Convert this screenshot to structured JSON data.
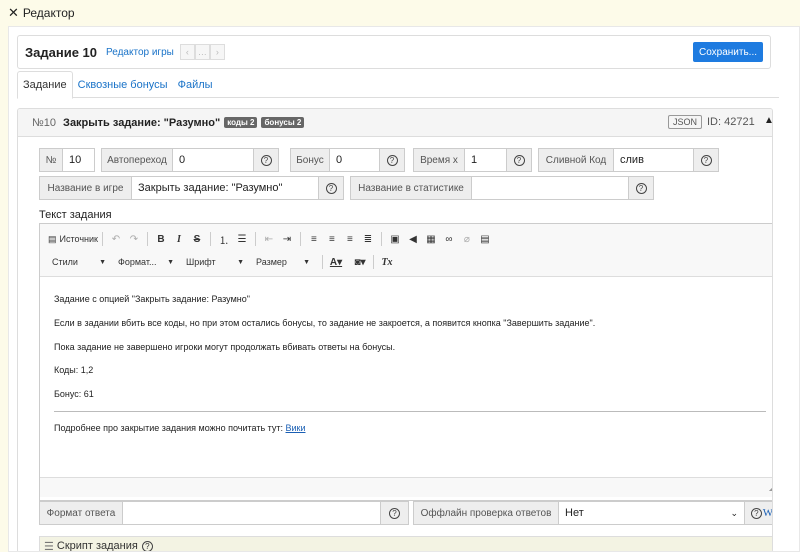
{
  "window": {
    "title": "Редактор"
  },
  "header": {
    "title": "Задание 10",
    "editor_link": "Редактор игры",
    "nav": [
      "‹",
      "…",
      "›"
    ],
    "save_label": "Сохранить..."
  },
  "tabs": [
    {
      "label": "Задание"
    },
    {
      "label": "Сквозные бонусы"
    },
    {
      "label": "Файлы"
    }
  ],
  "task": {
    "num": "№10",
    "title": "Закрыть задание: \"Разумно\"",
    "badges": [
      "коды 2",
      "бонусы 2"
    ],
    "json_label": "JSON",
    "id_text": "ID: 42721",
    "collapse_icon": "▲"
  },
  "fields": {
    "number": {
      "label": "№",
      "value": "10"
    },
    "autojump": {
      "label": "Автопереход",
      "value": "0"
    },
    "bonus": {
      "label": "Бонус",
      "value": "0"
    },
    "time": {
      "label": "Время x",
      "value": "1"
    },
    "merge_code": {
      "label": "Сливной Код",
      "value": "слив"
    },
    "game_name": {
      "label": "Название в игре",
      "value": "Закрыть задание: \"Разумно\""
    },
    "stat_name": {
      "label": "Название в статистике",
      "value": ""
    },
    "answer_format": {
      "label": "Формат ответа",
      "value": ""
    },
    "offline_check": {
      "label": "Оффлайн проверка ответов",
      "value": "Нет"
    },
    "help_icon": "?"
  },
  "text_label": "Текст задания",
  "toolbar": {
    "source_label": "Источник",
    "styles": "Стили",
    "format": "Формат...",
    "font": "Шрифт",
    "size": "Размер"
  },
  "content": {
    "p1": "Задание с опцией \"Закрыть задание: Разумно\"",
    "p2": "Если в задании вбить все коды, но при этом остались бонусы, то задание не закроется, а появится кнопка \"Завершить задание\".",
    "p3": "Пока задание не завершено игроки могут продолжать вбивать ответы на бонусы.",
    "p4": "Коды: 1,2",
    "p5": "Бонус: 61",
    "p6_text": "Подробнее про закрытие задания можно почитать тут: ",
    "p6_link": "Вики"
  },
  "script_label": "Скрипт задания",
  "wiki_icon_label": "W"
}
